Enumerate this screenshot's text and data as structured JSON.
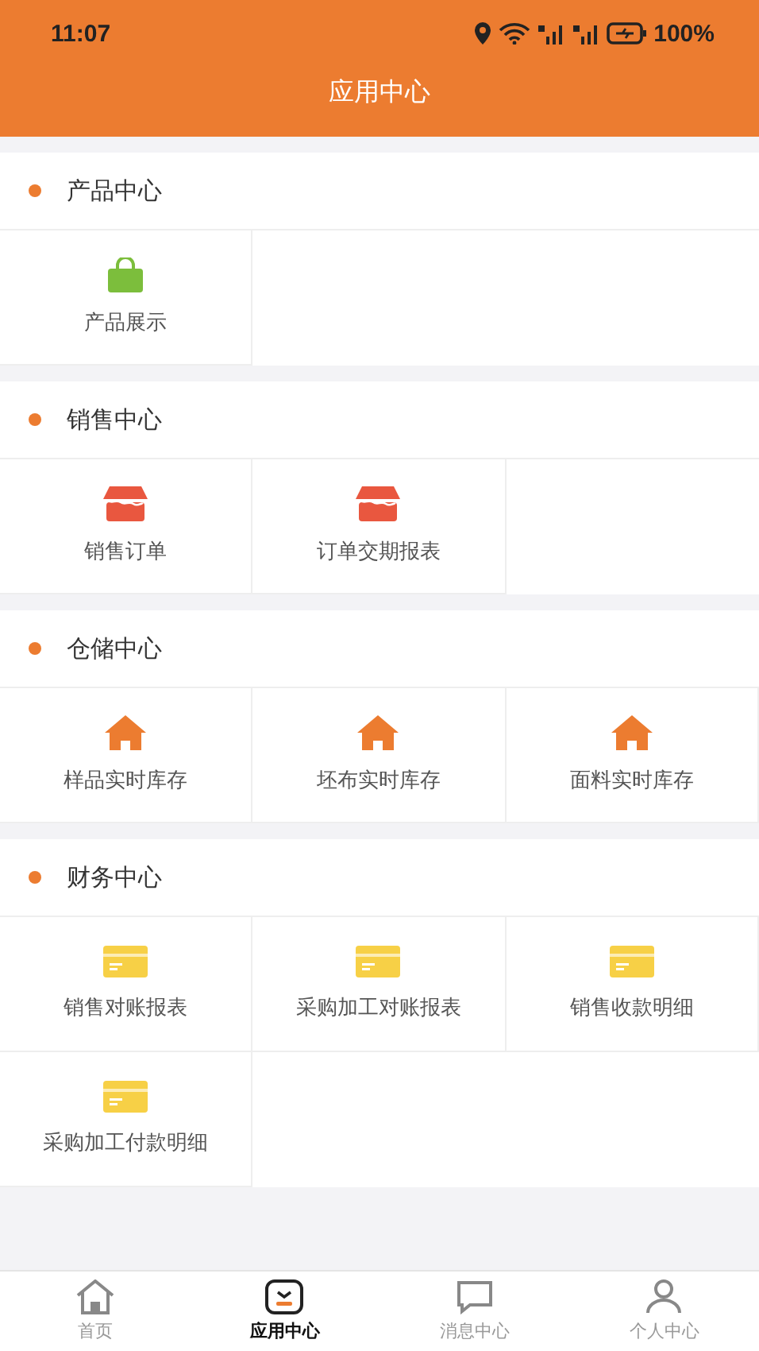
{
  "status_bar": {
    "time": "11:07",
    "battery": "100%"
  },
  "header": {
    "title": "应用中心"
  },
  "sections": [
    {
      "title": "产品中心",
      "items": [
        {
          "label": "产品展示",
          "kind": "bag"
        }
      ]
    },
    {
      "title": "销售中心",
      "items": [
        {
          "label": "销售订单",
          "kind": "box"
        },
        {
          "label": "订单交期报表",
          "kind": "box"
        }
      ]
    },
    {
      "title": "仓储中心",
      "items": [
        {
          "label": "样品实时库存",
          "kind": "house"
        },
        {
          "label": "坯布实时库存",
          "kind": "house"
        },
        {
          "label": "面料实时库存",
          "kind": "house"
        }
      ]
    },
    {
      "title": "财务中心",
      "items": [
        {
          "label": "销售对账报表",
          "kind": "card"
        },
        {
          "label": "采购加工对账报表",
          "kind": "card"
        },
        {
          "label": "销售收款明细",
          "kind": "card"
        },
        {
          "label": "采购加工付款明细",
          "kind": "card"
        }
      ]
    }
  ],
  "tabs": [
    {
      "label": "首页",
      "kind": "home",
      "selected": false
    },
    {
      "label": "应用中心",
      "kind": "apps",
      "selected": true
    },
    {
      "label": "消息中心",
      "kind": "message",
      "selected": false
    },
    {
      "label": "个人中心",
      "kind": "person",
      "selected": false
    }
  ]
}
